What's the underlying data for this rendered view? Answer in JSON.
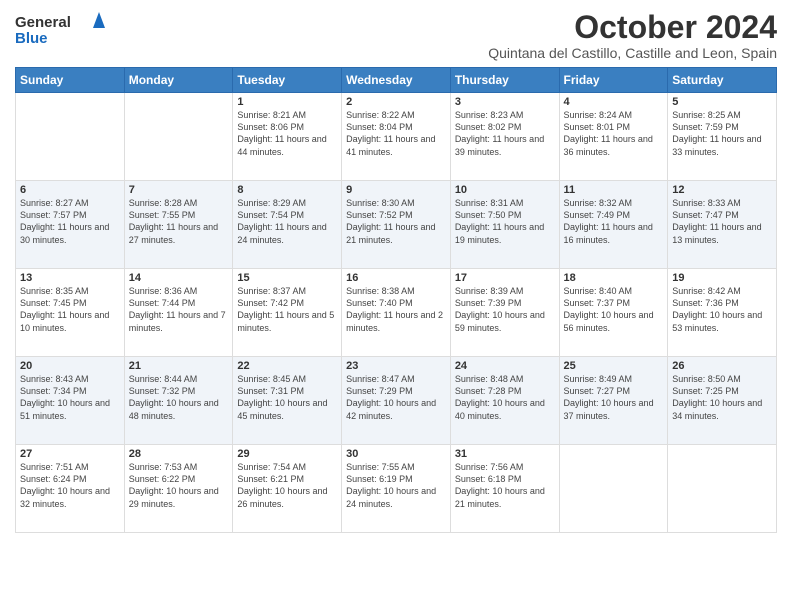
{
  "header": {
    "logo_general": "General",
    "logo_blue": "Blue",
    "main_title": "October 2024",
    "subtitle": "Quintana del Castillo, Castille and Leon, Spain"
  },
  "days_of_week": [
    "Sunday",
    "Monday",
    "Tuesday",
    "Wednesday",
    "Thursday",
    "Friday",
    "Saturday"
  ],
  "weeks": [
    [
      {
        "day": "",
        "info": ""
      },
      {
        "day": "",
        "info": ""
      },
      {
        "day": "1",
        "info": "Sunrise: 8:21 AM\nSunset: 8:06 PM\nDaylight: 11 hours and 44 minutes."
      },
      {
        "day": "2",
        "info": "Sunrise: 8:22 AM\nSunset: 8:04 PM\nDaylight: 11 hours and 41 minutes."
      },
      {
        "day": "3",
        "info": "Sunrise: 8:23 AM\nSunset: 8:02 PM\nDaylight: 11 hours and 39 minutes."
      },
      {
        "day": "4",
        "info": "Sunrise: 8:24 AM\nSunset: 8:01 PM\nDaylight: 11 hours and 36 minutes."
      },
      {
        "day": "5",
        "info": "Sunrise: 8:25 AM\nSunset: 7:59 PM\nDaylight: 11 hours and 33 minutes."
      }
    ],
    [
      {
        "day": "6",
        "info": "Sunrise: 8:27 AM\nSunset: 7:57 PM\nDaylight: 11 hours and 30 minutes."
      },
      {
        "day": "7",
        "info": "Sunrise: 8:28 AM\nSunset: 7:55 PM\nDaylight: 11 hours and 27 minutes."
      },
      {
        "day": "8",
        "info": "Sunrise: 8:29 AM\nSunset: 7:54 PM\nDaylight: 11 hours and 24 minutes."
      },
      {
        "day": "9",
        "info": "Sunrise: 8:30 AM\nSunset: 7:52 PM\nDaylight: 11 hours and 21 minutes."
      },
      {
        "day": "10",
        "info": "Sunrise: 8:31 AM\nSunset: 7:50 PM\nDaylight: 11 hours and 19 minutes."
      },
      {
        "day": "11",
        "info": "Sunrise: 8:32 AM\nSunset: 7:49 PM\nDaylight: 11 hours and 16 minutes."
      },
      {
        "day": "12",
        "info": "Sunrise: 8:33 AM\nSunset: 7:47 PM\nDaylight: 11 hours and 13 minutes."
      }
    ],
    [
      {
        "day": "13",
        "info": "Sunrise: 8:35 AM\nSunset: 7:45 PM\nDaylight: 11 hours and 10 minutes."
      },
      {
        "day": "14",
        "info": "Sunrise: 8:36 AM\nSunset: 7:44 PM\nDaylight: 11 hours and 7 minutes."
      },
      {
        "day": "15",
        "info": "Sunrise: 8:37 AM\nSunset: 7:42 PM\nDaylight: 11 hours and 5 minutes."
      },
      {
        "day": "16",
        "info": "Sunrise: 8:38 AM\nSunset: 7:40 PM\nDaylight: 11 hours and 2 minutes."
      },
      {
        "day": "17",
        "info": "Sunrise: 8:39 AM\nSunset: 7:39 PM\nDaylight: 10 hours and 59 minutes."
      },
      {
        "day": "18",
        "info": "Sunrise: 8:40 AM\nSunset: 7:37 PM\nDaylight: 10 hours and 56 minutes."
      },
      {
        "day": "19",
        "info": "Sunrise: 8:42 AM\nSunset: 7:36 PM\nDaylight: 10 hours and 53 minutes."
      }
    ],
    [
      {
        "day": "20",
        "info": "Sunrise: 8:43 AM\nSunset: 7:34 PM\nDaylight: 10 hours and 51 minutes."
      },
      {
        "day": "21",
        "info": "Sunrise: 8:44 AM\nSunset: 7:32 PM\nDaylight: 10 hours and 48 minutes."
      },
      {
        "day": "22",
        "info": "Sunrise: 8:45 AM\nSunset: 7:31 PM\nDaylight: 10 hours and 45 minutes."
      },
      {
        "day": "23",
        "info": "Sunrise: 8:47 AM\nSunset: 7:29 PM\nDaylight: 10 hours and 42 minutes."
      },
      {
        "day": "24",
        "info": "Sunrise: 8:48 AM\nSunset: 7:28 PM\nDaylight: 10 hours and 40 minutes."
      },
      {
        "day": "25",
        "info": "Sunrise: 8:49 AM\nSunset: 7:27 PM\nDaylight: 10 hours and 37 minutes."
      },
      {
        "day": "26",
        "info": "Sunrise: 8:50 AM\nSunset: 7:25 PM\nDaylight: 10 hours and 34 minutes."
      }
    ],
    [
      {
        "day": "27",
        "info": "Sunrise: 7:51 AM\nSunset: 6:24 PM\nDaylight: 10 hours and 32 minutes."
      },
      {
        "day": "28",
        "info": "Sunrise: 7:53 AM\nSunset: 6:22 PM\nDaylight: 10 hours and 29 minutes."
      },
      {
        "day": "29",
        "info": "Sunrise: 7:54 AM\nSunset: 6:21 PM\nDaylight: 10 hours and 26 minutes."
      },
      {
        "day": "30",
        "info": "Sunrise: 7:55 AM\nSunset: 6:19 PM\nDaylight: 10 hours and 24 minutes."
      },
      {
        "day": "31",
        "info": "Sunrise: 7:56 AM\nSunset: 6:18 PM\nDaylight: 10 hours and 21 minutes."
      },
      {
        "day": "",
        "info": ""
      },
      {
        "day": "",
        "info": ""
      }
    ]
  ]
}
